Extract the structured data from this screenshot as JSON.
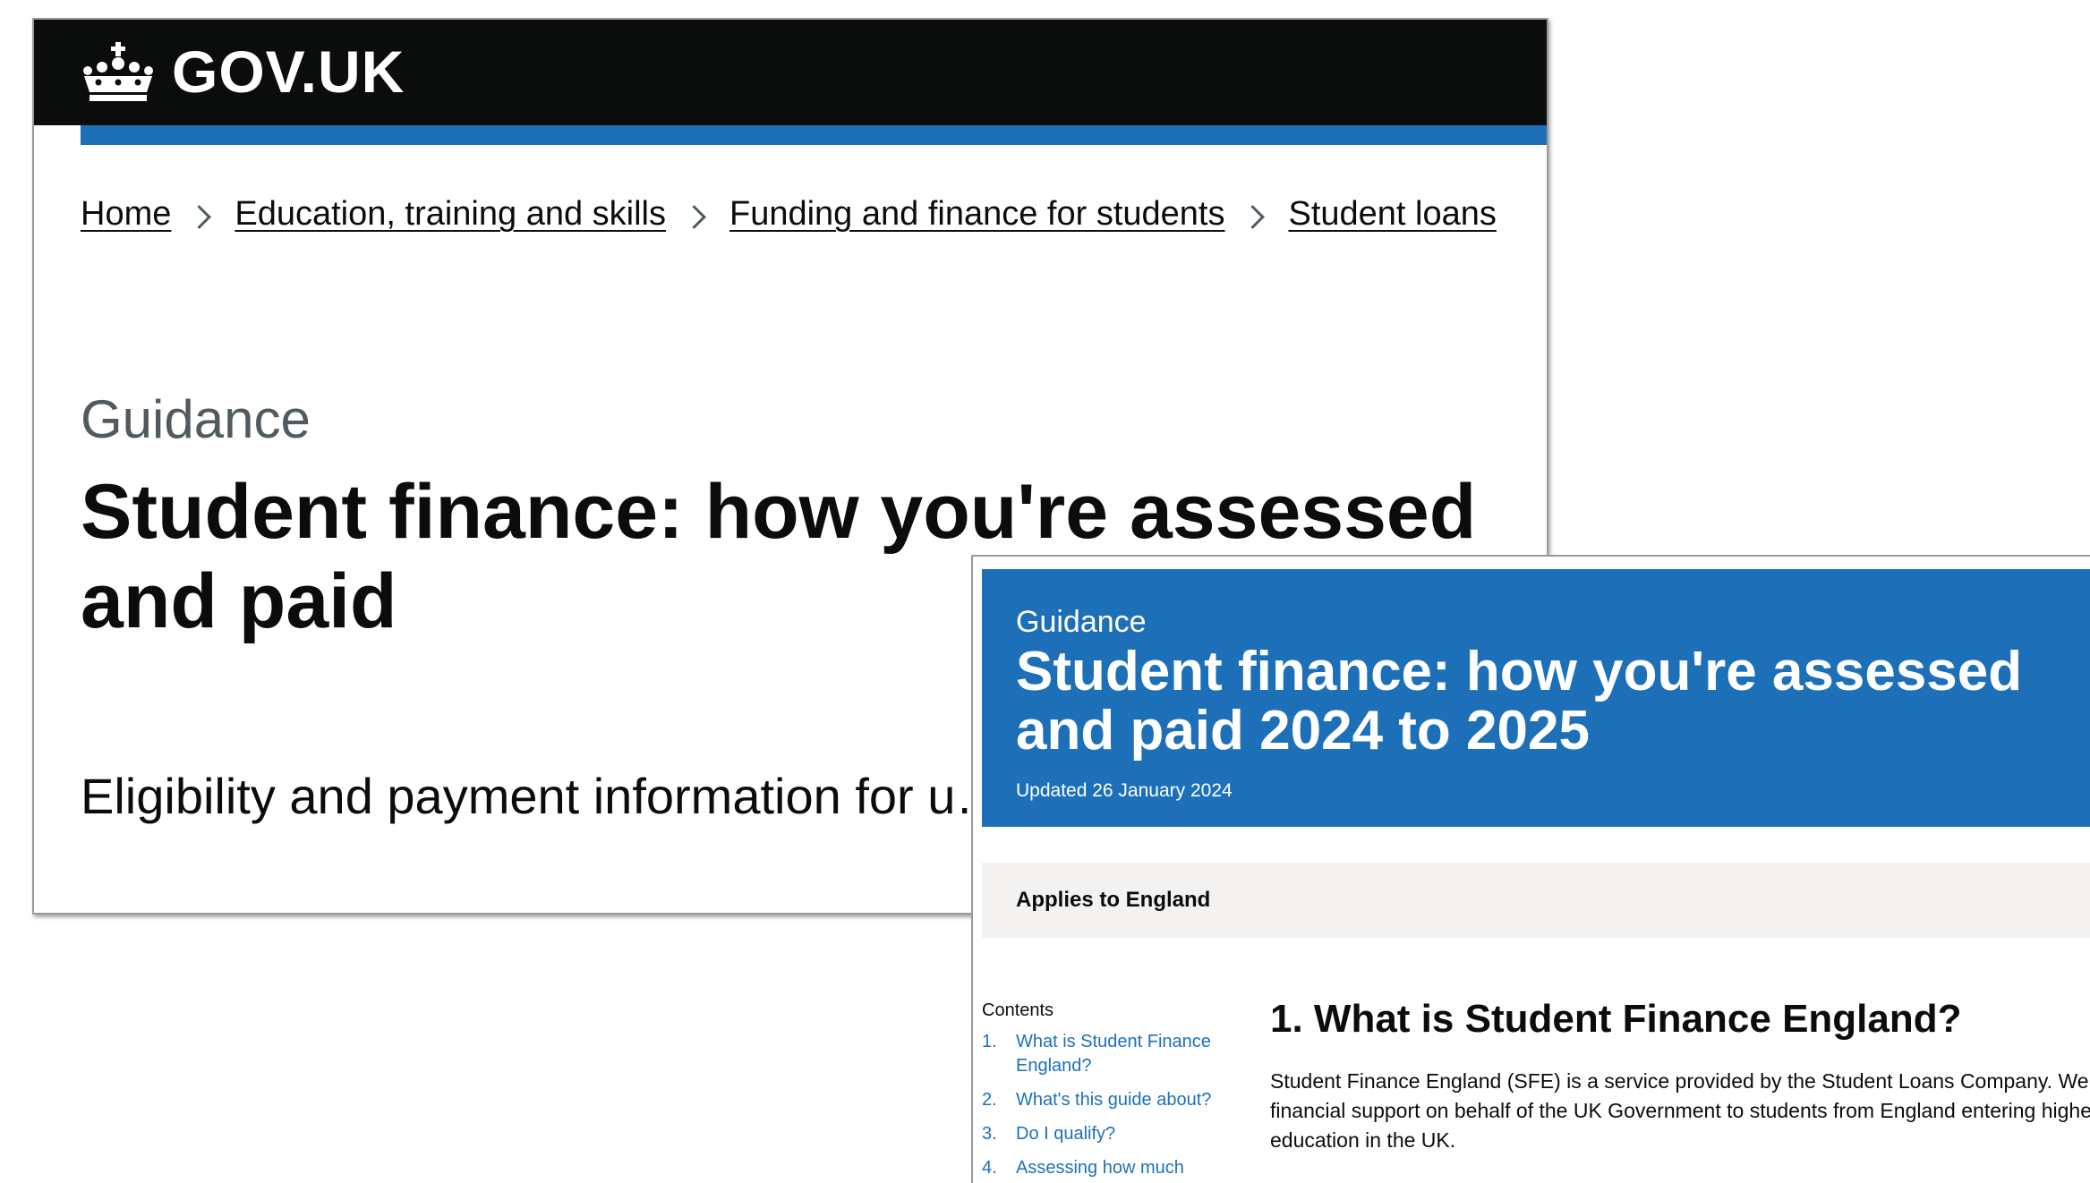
{
  "back_page": {
    "header": {
      "logo_text": "GOV.UK",
      "logo_icon": "crown-icon"
    },
    "breadcrumbs": [
      "Home",
      "Education, training and skills",
      "Funding and finance for students",
      "Student loans"
    ],
    "caption": "Guidance",
    "title": "Student finance: how you're assessed and paid",
    "lead": "Eligibility and payment information for u… students."
  },
  "front_page": {
    "caption": "Guidance",
    "title": "Student finance: how you're assessed and paid 2024 to 2025",
    "updated": "Updated 26 January 2024",
    "applies_to": "Applies to England",
    "contents": {
      "heading": "Contents",
      "items": [
        {
          "num": "1.",
          "label": "What is Student Finance England?"
        },
        {
          "num": "2.",
          "label": "What's this guide about?"
        },
        {
          "num": "3.",
          "label": "Do I qualify?"
        },
        {
          "num": "4.",
          "label": "Assessing how much"
        }
      ]
    },
    "section": {
      "title": "1. What is Student Finance England?",
      "body": "Student Finance England (SFE) is a service provided by the Student Loans Company. We provide financial support on behalf of the UK Government to students from England entering higher education in the UK."
    }
  },
  "colors": {
    "gov_black": "#0b0c0c",
    "gov_blue": "#1d70b8",
    "secondary_text": "#505a5f",
    "inset_grey": "#f3f2f1"
  }
}
